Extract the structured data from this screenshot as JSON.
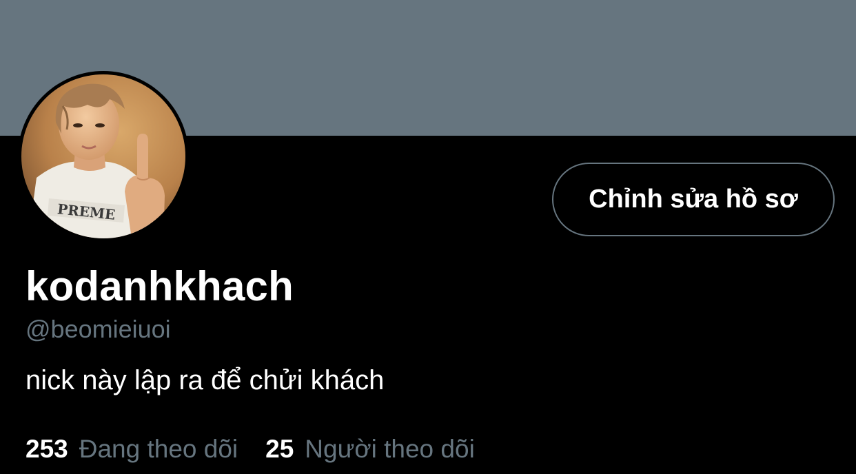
{
  "profile": {
    "banner_color": "#66757f",
    "display_name": "kodanhkhach",
    "handle": "@beomieiuoi",
    "bio": "nick này lập ra để chửi khách",
    "avatar_icon": "profile-photo"
  },
  "actions": {
    "edit_profile_label": "Chỉnh sửa hồ sơ"
  },
  "stats": {
    "following_count": "253",
    "following_label": "Đang theo dõi",
    "followers_count": "25",
    "followers_label": "Người theo dõi"
  },
  "colors": {
    "background": "#000000",
    "primary_text": "#ffffff",
    "secondary_text": "#66757f",
    "button_border": "#66757f"
  }
}
